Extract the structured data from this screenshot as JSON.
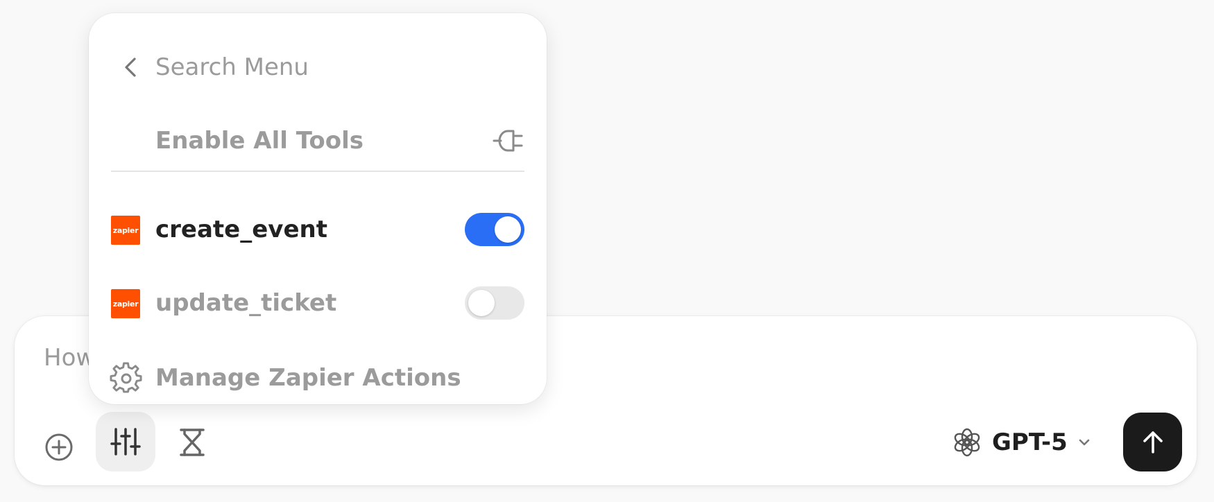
{
  "composer": {
    "placeholder": "How can I help?",
    "model_label": "GPT-5",
    "icons": {
      "plus": "plus-circle-icon",
      "tools": "sliders-icon",
      "hourglass": "hourglass-icon",
      "model": "openai-logo-icon",
      "chevron": "chevron-down-icon",
      "send": "arrow-up-icon"
    }
  },
  "menu": {
    "search_placeholder": "Search Menu",
    "enable_all_label": "Enable All Tools",
    "tools": [
      {
        "name": "create_event",
        "logo_text": "zapier",
        "enabled": true
      },
      {
        "name": "update_ticket",
        "logo_text": "zapier",
        "enabled": false
      }
    ],
    "manage_label": "Manage Zapier Actions"
  },
  "colors": {
    "accent_toggle_on": "#2a6ef5",
    "zapier_brand": "#ff4f00",
    "send_button": "#1b1b1b"
  }
}
